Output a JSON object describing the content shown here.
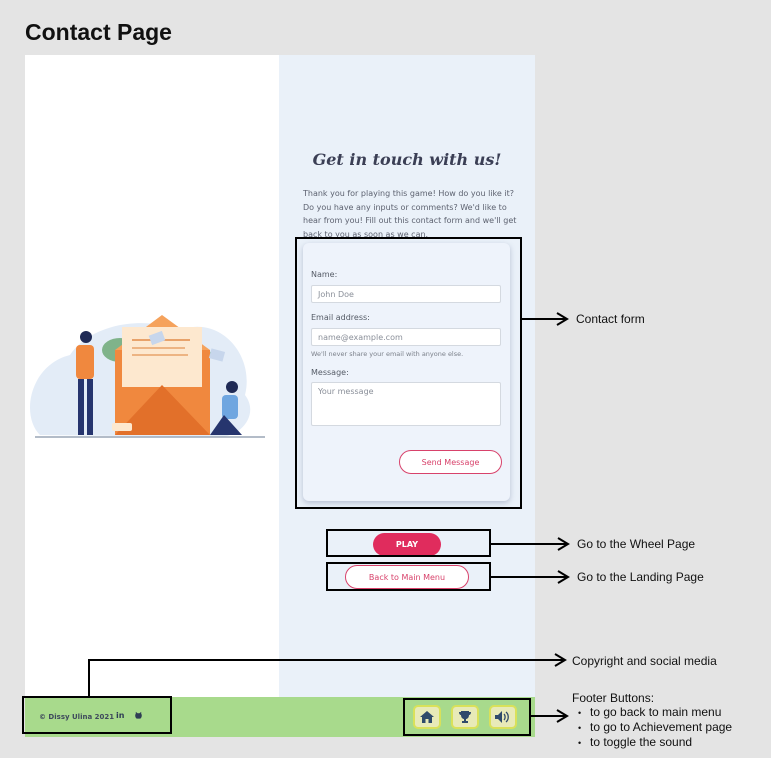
{
  "page_title": "Contact Page",
  "contact": {
    "heading": "Get in touch with us!",
    "intro": "Thank you for playing this game! How do you like it? Do you have any inputs or comments? We'd like to hear from you! Fill out this contact form and we'll get back to you as soon as we can.",
    "name_label": "Name:",
    "name_placeholder": "John Doe",
    "email_label": "Email address:",
    "email_placeholder": "name@example.com",
    "email_hint": "We'll never share your email with anyone else.",
    "message_label": "Message:",
    "message_placeholder": "Your message",
    "send_label": "Send Message"
  },
  "buttons": {
    "play": "PLAY",
    "back": "Back to Main Menu"
  },
  "footer": {
    "copyright": "© Dissy Ulina 2021",
    "linkedin": "in",
    "github": "gh",
    "buttons": [
      {
        "icon": "home-icon"
      },
      {
        "icon": "trophy-icon"
      },
      {
        "icon": "sound-icon"
      }
    ]
  },
  "colors": {
    "accent": "#e02c5d",
    "footer": "#a8da8c",
    "panel": "#eaf1f9"
  },
  "annotations": {
    "contact_form": "Contact form",
    "play": "Go to the Wheel Page",
    "back": "Go to the Landing Page",
    "copyright": "Copyright and social media",
    "footer_title": "Footer Buttons:",
    "footer_items": [
      "to go back to main menu",
      "to go to Achievement page",
      "to toggle the sound"
    ]
  }
}
